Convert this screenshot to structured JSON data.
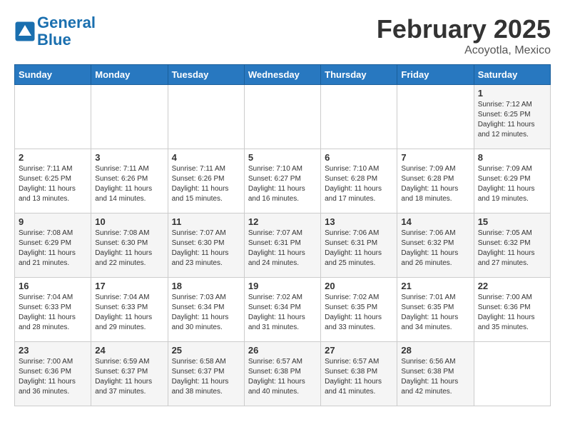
{
  "header": {
    "logo_line1": "General",
    "logo_line2": "Blue",
    "month_year": "February 2025",
    "location": "Acoyotla, Mexico"
  },
  "days_of_week": [
    "Sunday",
    "Monday",
    "Tuesday",
    "Wednesday",
    "Thursday",
    "Friday",
    "Saturday"
  ],
  "weeks": [
    [
      {
        "day": "",
        "info": ""
      },
      {
        "day": "",
        "info": ""
      },
      {
        "day": "",
        "info": ""
      },
      {
        "day": "",
        "info": ""
      },
      {
        "day": "",
        "info": ""
      },
      {
        "day": "",
        "info": ""
      },
      {
        "day": "1",
        "info": "Sunrise: 7:12 AM\nSunset: 6:25 PM\nDaylight: 11 hours and 12 minutes."
      }
    ],
    [
      {
        "day": "2",
        "info": "Sunrise: 7:11 AM\nSunset: 6:25 PM\nDaylight: 11 hours and 13 minutes."
      },
      {
        "day": "3",
        "info": "Sunrise: 7:11 AM\nSunset: 6:26 PM\nDaylight: 11 hours and 14 minutes."
      },
      {
        "day": "4",
        "info": "Sunrise: 7:11 AM\nSunset: 6:26 PM\nDaylight: 11 hours and 15 minutes."
      },
      {
        "day": "5",
        "info": "Sunrise: 7:10 AM\nSunset: 6:27 PM\nDaylight: 11 hours and 16 minutes."
      },
      {
        "day": "6",
        "info": "Sunrise: 7:10 AM\nSunset: 6:28 PM\nDaylight: 11 hours and 17 minutes."
      },
      {
        "day": "7",
        "info": "Sunrise: 7:09 AM\nSunset: 6:28 PM\nDaylight: 11 hours and 18 minutes."
      },
      {
        "day": "8",
        "info": "Sunrise: 7:09 AM\nSunset: 6:29 PM\nDaylight: 11 hours and 19 minutes."
      }
    ],
    [
      {
        "day": "9",
        "info": "Sunrise: 7:08 AM\nSunset: 6:29 PM\nDaylight: 11 hours and 21 minutes."
      },
      {
        "day": "10",
        "info": "Sunrise: 7:08 AM\nSunset: 6:30 PM\nDaylight: 11 hours and 22 minutes."
      },
      {
        "day": "11",
        "info": "Sunrise: 7:07 AM\nSunset: 6:30 PM\nDaylight: 11 hours and 23 minutes."
      },
      {
        "day": "12",
        "info": "Sunrise: 7:07 AM\nSunset: 6:31 PM\nDaylight: 11 hours and 24 minutes."
      },
      {
        "day": "13",
        "info": "Sunrise: 7:06 AM\nSunset: 6:31 PM\nDaylight: 11 hours and 25 minutes."
      },
      {
        "day": "14",
        "info": "Sunrise: 7:06 AM\nSunset: 6:32 PM\nDaylight: 11 hours and 26 minutes."
      },
      {
        "day": "15",
        "info": "Sunrise: 7:05 AM\nSunset: 6:32 PM\nDaylight: 11 hours and 27 minutes."
      }
    ],
    [
      {
        "day": "16",
        "info": "Sunrise: 7:04 AM\nSunset: 6:33 PM\nDaylight: 11 hours and 28 minutes."
      },
      {
        "day": "17",
        "info": "Sunrise: 7:04 AM\nSunset: 6:33 PM\nDaylight: 11 hours and 29 minutes."
      },
      {
        "day": "18",
        "info": "Sunrise: 7:03 AM\nSunset: 6:34 PM\nDaylight: 11 hours and 30 minutes."
      },
      {
        "day": "19",
        "info": "Sunrise: 7:02 AM\nSunset: 6:34 PM\nDaylight: 11 hours and 31 minutes."
      },
      {
        "day": "20",
        "info": "Sunrise: 7:02 AM\nSunset: 6:35 PM\nDaylight: 11 hours and 33 minutes."
      },
      {
        "day": "21",
        "info": "Sunrise: 7:01 AM\nSunset: 6:35 PM\nDaylight: 11 hours and 34 minutes."
      },
      {
        "day": "22",
        "info": "Sunrise: 7:00 AM\nSunset: 6:36 PM\nDaylight: 11 hours and 35 minutes."
      }
    ],
    [
      {
        "day": "23",
        "info": "Sunrise: 7:00 AM\nSunset: 6:36 PM\nDaylight: 11 hours and 36 minutes."
      },
      {
        "day": "24",
        "info": "Sunrise: 6:59 AM\nSunset: 6:37 PM\nDaylight: 11 hours and 37 minutes."
      },
      {
        "day": "25",
        "info": "Sunrise: 6:58 AM\nSunset: 6:37 PM\nDaylight: 11 hours and 38 minutes."
      },
      {
        "day": "26",
        "info": "Sunrise: 6:57 AM\nSunset: 6:38 PM\nDaylight: 11 hours and 40 minutes."
      },
      {
        "day": "27",
        "info": "Sunrise: 6:57 AM\nSunset: 6:38 PM\nDaylight: 11 hours and 41 minutes."
      },
      {
        "day": "28",
        "info": "Sunrise: 6:56 AM\nSunset: 6:38 PM\nDaylight: 11 hours and 42 minutes."
      },
      {
        "day": "",
        "info": ""
      }
    ]
  ]
}
